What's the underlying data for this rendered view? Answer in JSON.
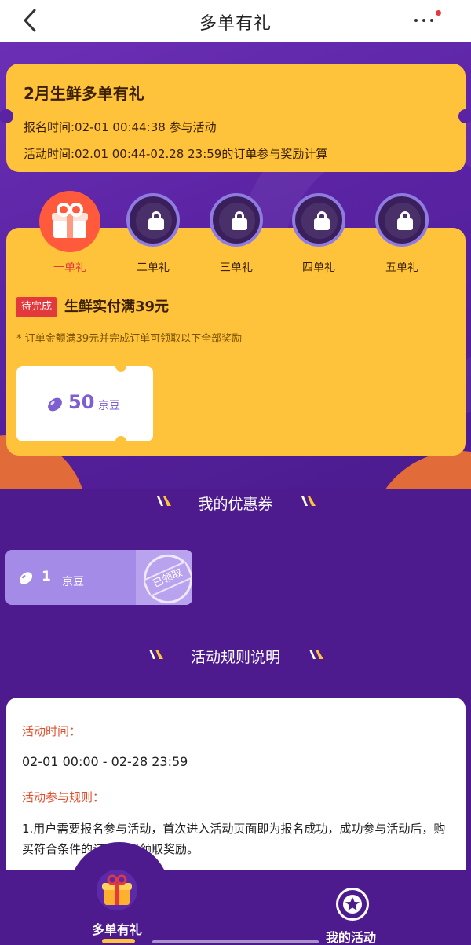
{
  "nav": {
    "title": "多单有礼"
  },
  "activity": {
    "title": "2月生鲜多单有礼",
    "signup_time": "报名时间:02-01 00:44:38 参与活动",
    "activity_time": "活动时间:02.01 00:44-02.28 23:59的订单参与奖励计算"
  },
  "steps": [
    {
      "label": "一单礼",
      "state": "active"
    },
    {
      "label": "二单礼",
      "state": "locked"
    },
    {
      "label": "三单礼",
      "state": "locked"
    },
    {
      "label": "四单礼",
      "state": "locked"
    },
    {
      "label": "五单礼",
      "state": "locked"
    }
  ],
  "current_step": {
    "status_badge": "待完成",
    "requirement": "生鲜实付满39元",
    "note": "* 订单金额满39元并完成订单可领取以下全部奖励",
    "reward": {
      "amount": "50",
      "unit": "京豆"
    }
  },
  "coupons_section": {
    "title": "我的优惠券",
    "coupons": [
      {
        "amount": "1",
        "unit": "京豆",
        "stamp": "已领取"
      }
    ]
  },
  "rules_section": {
    "title": "活动规则说明",
    "time_heading": "活动时间：",
    "time_value": "02-01 00:00 - 02-28 23:59",
    "rules_heading": "活动参与规则：",
    "rule_1": "1.用户需要报名参与活动，首次进入活动页面即为报名成功，成功参与活动后，购买符合条件的订单可以领取奖励。"
  },
  "tabbar": {
    "tabs": [
      {
        "label": "多单有礼",
        "active": true
      },
      {
        "label": "我的活动",
        "active": false
      }
    ]
  },
  "colors": {
    "brand_purple": "#4e1b8e",
    "card_yellow": "#ffc23b",
    "accent_red": "#e4393c",
    "bean_purple": "#7d5fd0"
  }
}
